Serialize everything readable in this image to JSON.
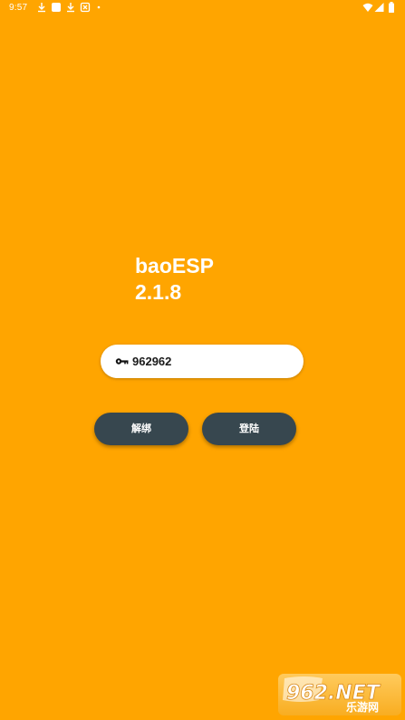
{
  "status_bar": {
    "time": "9:57",
    "left_icons": [
      "download-icon",
      "notification-square-icon",
      "download-icon",
      "app-notification-icon",
      "dot-icon"
    ],
    "right_icons": [
      "wifi-icon",
      "cellular-signal-icon",
      "battery-icon"
    ]
  },
  "app": {
    "name": "baoESP",
    "version": "2.1.8"
  },
  "key_field": {
    "icon": "key-icon",
    "value": "962962"
  },
  "buttons": {
    "unbind_label": "解绑",
    "login_label": "登陆"
  },
  "watermark": {
    "text_top": "962.NET",
    "text_bottom": "乐游网"
  },
  "colors": {
    "background": "#FFA500",
    "button": "#37474F",
    "field": "#FFFFFF",
    "text_light": "#FFFFFF"
  }
}
